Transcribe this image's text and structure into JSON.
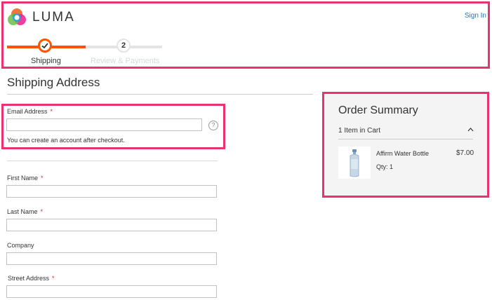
{
  "brand": {
    "name": "LUMA"
  },
  "header": {
    "signin_label": "Sign In"
  },
  "progress": {
    "steps": [
      {
        "number": "",
        "label": "Shipping",
        "state": "complete"
      },
      {
        "number": "2",
        "label": "Review & Payments",
        "state": "pending"
      }
    ]
  },
  "shipping": {
    "title": "Shipping Address",
    "email": {
      "label": "Email Address",
      "required_mark": "*",
      "value": "",
      "help_glyph": "?",
      "note": "You can create an account after checkout."
    },
    "fields": [
      {
        "label": "First Name",
        "required_mark": "*",
        "value": ""
      },
      {
        "label": "Last Name",
        "required_mark": "*",
        "value": ""
      },
      {
        "label": "Company",
        "required_mark": "",
        "value": ""
      },
      {
        "label": "Street Address",
        "required_mark": "*",
        "value": ""
      }
    ]
  },
  "summary": {
    "title": "Order Summary",
    "cart_count": "1 Item in Cart",
    "items": [
      {
        "name": "Affirm Water Bottle",
        "price": "$7.00",
        "qty": "Qty: 1"
      }
    ]
  },
  "colors": {
    "accent": "#ff5501",
    "highlight": "#e8336f",
    "link": "#1979c3",
    "required": "#e02b27",
    "summary_bg": "#f4f4f4"
  },
  "icons": {
    "logo": "luma-logo-icon",
    "help": "question-circle-icon",
    "checkmark": "checkmark-icon",
    "chevron": "chevron-up-icon",
    "product": "water-bottle-image"
  }
}
